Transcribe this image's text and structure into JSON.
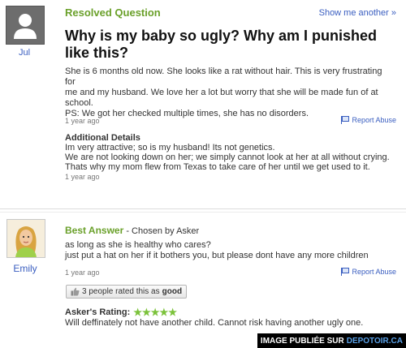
{
  "question": {
    "status": "Resolved Question",
    "show_another": "Show me another »",
    "asker_name": "Jul",
    "title": "Why is my baby so ugly? Why am I punished like this?",
    "body_lines": [
      "She is 6 months old now. She looks like a rat without hair. This is very frustrating for",
      "me and my husband. We love her a lot but worry that she will be made fun of at",
      "school.",
      "PS: We got her checked multiple times, she has no disorders."
    ],
    "time": "1 year ago",
    "report": "Report Abuse",
    "additional_heading": "Additional Details",
    "additional_lines": [
      "Im very attractive; so is my husband! Its not genetics.",
      "We are not looking down on her; we simply cannot look at her at all without crying.",
      "Thats why my mom flew from Texas to take care of her until we get used to it."
    ],
    "additional_time": "1 year ago"
  },
  "answer": {
    "label": "Best Answer",
    "chosen_by": "- Chosen by Asker",
    "answerer_name": "Emily",
    "body_lines": [
      "as long as she is healthy who cares?",
      "just put a hat on her if it bothers you, but please dont have any more children"
    ],
    "time": "1 year ago",
    "report": "Report Abuse",
    "rated_prefix": "3 people rated this as",
    "rated_value": "good",
    "askers_rating_label": "Asker's Rating:",
    "stars": "★★★★★",
    "rating_count": 5,
    "rating_comment": "Will deffinately not have another child. Cannot risk having another ugly one."
  },
  "watermark": {
    "prefix": "IMAGE PUBLIÉE SUR",
    "site": "DEPOTOIR.CA"
  },
  "colors": {
    "accent_green": "#6aa02a",
    "link_blue": "#3a5ec0",
    "star_green": "#7bc23a"
  }
}
